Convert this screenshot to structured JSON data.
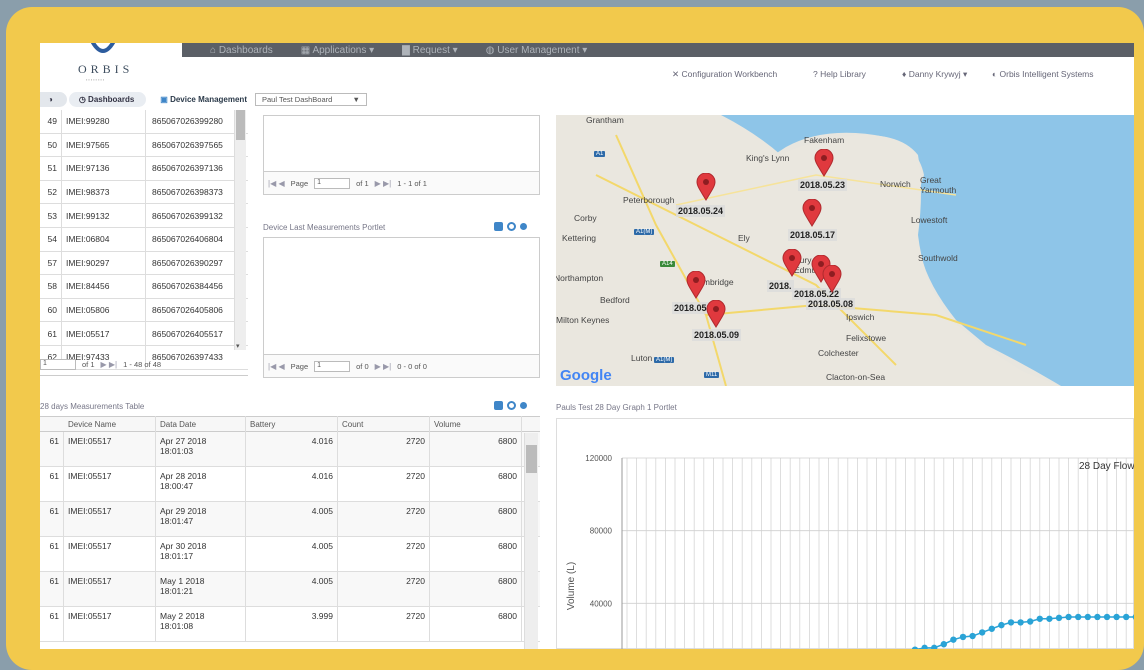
{
  "nav": {
    "items": [
      "Dashboards",
      "Applications",
      "Request",
      "User Management"
    ]
  },
  "logo": {
    "text": "ORBIS"
  },
  "util": {
    "config": "Configuration Workbench",
    "help": "Help Library",
    "user": "Danny Krywyj",
    "company": "Orbis Intelligent Systems"
  },
  "crumbs": {
    "home": "Dashboards",
    "device": "Device Management",
    "dashboard_select": "Paul Test DashBoard"
  },
  "devices": [
    {
      "n": "49",
      "name": "IMEI:99280",
      "imei": "865067026399280"
    },
    {
      "n": "50",
      "name": "IMEI:97565",
      "imei": "865067026397565"
    },
    {
      "n": "51",
      "name": "IMEI:97136",
      "imei": "865067026397136"
    },
    {
      "n": "52",
      "name": "IMEI:98373",
      "imei": "865067026398373"
    },
    {
      "n": "53",
      "name": "IMEI:99132",
      "imei": "865067026399132"
    },
    {
      "n": "54",
      "name": "IMEI:06804",
      "imei": "865067026406804"
    },
    {
      "n": "57",
      "name": "IMEI:90297",
      "imei": "865067026390297"
    },
    {
      "n": "58",
      "name": "IMEI:84456",
      "imei": "865067026384456"
    },
    {
      "n": "60",
      "name": "IMEI:05806",
      "imei": "865067026405806"
    },
    {
      "n": "61",
      "name": "IMEI:05517",
      "imei": "865067026405517"
    },
    {
      "n": "62",
      "name": "IMEI:97433",
      "imei": "865067026397433"
    }
  ],
  "dev_pager": {
    "page": "1",
    "of": "of 1",
    "range": "1 - 48 of 48"
  },
  "portlet1_pager": {
    "label": "Page",
    "page": "1",
    "of": "of 1",
    "range": "1 - 1 of 1"
  },
  "portlet2": {
    "title": "Device Last Measurements Portlet"
  },
  "portlet2_pager": {
    "label": "Page",
    "page": "1",
    "of": "of 0",
    "range": "0 - 0 of 0"
  },
  "meas": {
    "title": "28 days Measurements Table",
    "headers": [
      "Device Name",
      "Data Date",
      "Battery",
      "Count",
      "Volume"
    ],
    "rows": [
      {
        "n": "61",
        "name": "IMEI:05517",
        "date": "Apr 27 2018",
        "time": "18:01:03",
        "battery": "4.016",
        "count": "2720",
        "volume": "6800"
      },
      {
        "n": "61",
        "name": "IMEI:05517",
        "date": "Apr 28 2018",
        "time": "18:00:47",
        "battery": "4.016",
        "count": "2720",
        "volume": "6800"
      },
      {
        "n": "61",
        "name": "IMEI:05517",
        "date": "Apr 29 2018",
        "time": "18:01:47",
        "battery": "4.005",
        "count": "2720",
        "volume": "6800"
      },
      {
        "n": "61",
        "name": "IMEI:05517",
        "date": "Apr 30 2018",
        "time": "18:01:17",
        "battery": "4.005",
        "count": "2720",
        "volume": "6800"
      },
      {
        "n": "61",
        "name": "IMEI:05517",
        "date": "May 1 2018",
        "time": "18:01:21",
        "battery": "4.005",
        "count": "2720",
        "volume": "6800"
      },
      {
        "n": "61",
        "name": "IMEI:05517",
        "date": "May 2 2018",
        "time": "18:01:08",
        "battery": "3.999",
        "count": "2720",
        "volume": "6800"
      }
    ]
  },
  "map": {
    "places": [
      "Grantham",
      "Fakenham",
      "King's Lynn",
      "Peterborough",
      "Norwich",
      "Great Yarmouth",
      "Corby",
      "Lowestoft",
      "Kettering",
      "Ely",
      "Southwold",
      "Bury St Edmunds",
      "Cambridge",
      "Bedford",
      "Milton Keynes",
      "Ipswich",
      "Felixstowe",
      "Colchester",
      "Luton",
      "Clacton-on-Sea",
      "Northampton"
    ],
    "roads": [
      "A1",
      "A1(M)",
      "A14",
      "A14",
      "A1(M)",
      "M11"
    ],
    "pins": [
      {
        "label": "2018.05.24"
      },
      {
        "label": "2018.05.23"
      },
      {
        "label": "2018.05.17"
      },
      {
        "label": "2018.05.22"
      },
      {
        "label": "2018."
      },
      {
        "label": "2018.05.08"
      },
      {
        "label": "2018.05.08"
      },
      {
        "label": "2018.05.09"
      }
    ],
    "attribution": "Google"
  },
  "graph": {
    "portlet_title": "Pauls Test 28 Day Graph 1 Portlet",
    "chart_title": "28 Day Flow"
  },
  "chart_data": {
    "type": "line",
    "title": "28 Day Flow",
    "xlabel": "",
    "ylabel": "Volume (L)",
    "ylim": [
      0,
      120000
    ],
    "yticks": [
      120000,
      80000,
      40000
    ],
    "grid": true,
    "series": [
      {
        "color": "#2aa3d6",
        "values": [
          0,
          0,
          0,
          0,
          0,
          0,
          0,
          0,
          0,
          0,
          0,
          0,
          0,
          0,
          0,
          0,
          0,
          0,
          0,
          0,
          0,
          0,
          0,
          0,
          2500,
          5500,
          8500,
          11500,
          11500,
          11500,
          14500,
          15500,
          15500,
          17500,
          20000,
          21500,
          22000,
          24000,
          26000,
          28000,
          29500,
          29500,
          30000,
          31500,
          31500,
          32000,
          32500,
          32500,
          32500,
          32500,
          32500,
          32500,
          32500,
          32500
        ]
      }
    ]
  }
}
